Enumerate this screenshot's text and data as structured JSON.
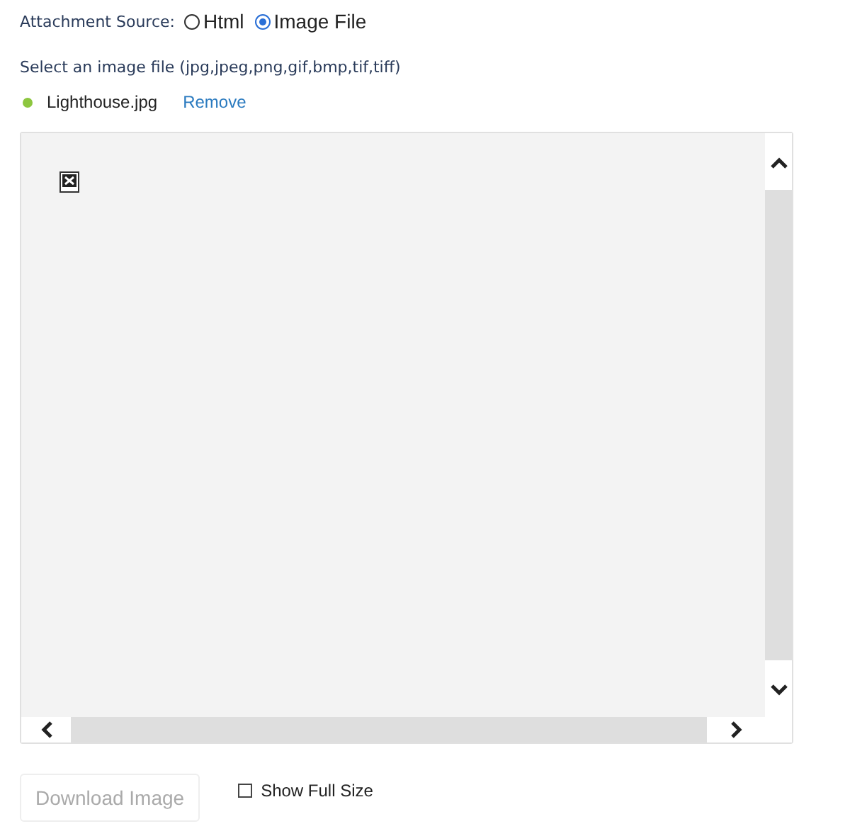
{
  "source": {
    "label": "Attachment Source:",
    "options": [
      {
        "label": "Html",
        "selected": false
      },
      {
        "label": "Image File",
        "selected": true
      }
    ]
  },
  "hint": "Select an image file (jpg,jpeg,png,gif,bmp,tif,tiff)",
  "file": {
    "name": "Lighthouse.jpg",
    "color": "#8dc63f",
    "remove": "Remove"
  },
  "download": {
    "label": "Download Image",
    "disabled": true
  },
  "full_size": {
    "label": "Show Full Size",
    "checked": false
  }
}
